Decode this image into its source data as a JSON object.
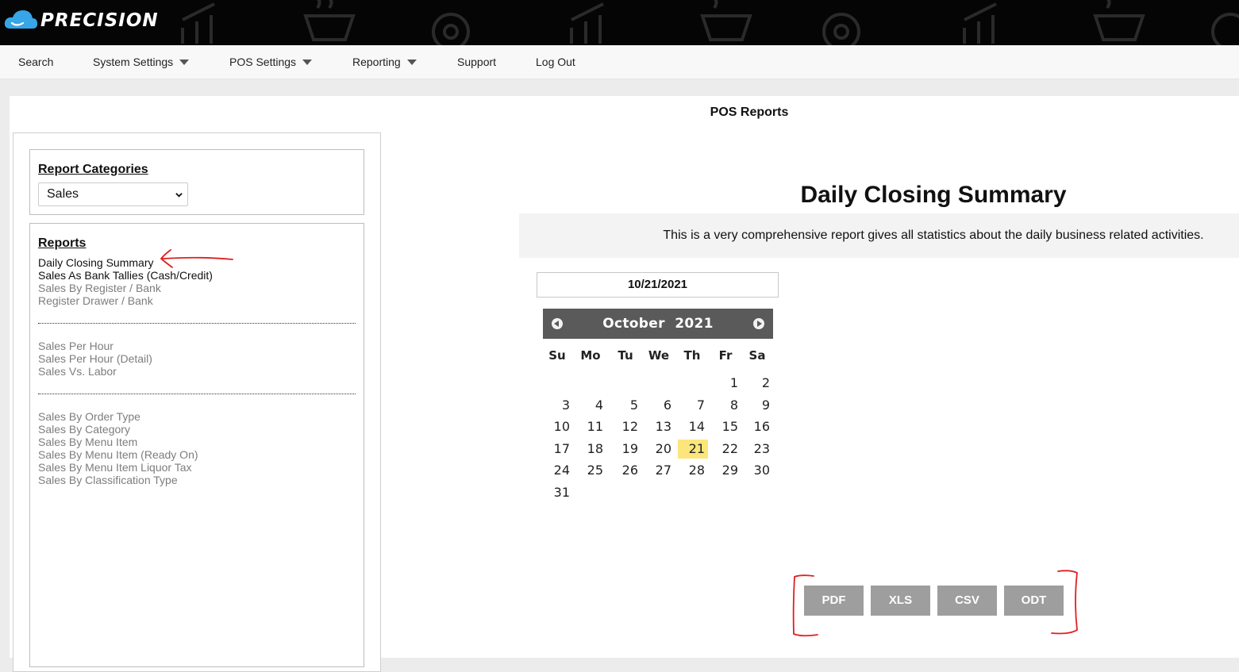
{
  "app": {
    "brand_name": "PRECISION"
  },
  "nav": {
    "items": [
      {
        "label": "Search"
      },
      {
        "label": "System Settings"
      },
      {
        "label": "POS Settings"
      },
      {
        "label": "Reporting"
      },
      {
        "label": "Support"
      },
      {
        "label": "Log Out"
      }
    ]
  },
  "page": {
    "title": "POS Reports"
  },
  "categories": {
    "heading": "Report Categories",
    "selected": "Sales"
  },
  "reports": {
    "heading": "Reports",
    "group1": [
      {
        "label": "Daily Closing Summary",
        "state": "active"
      },
      {
        "label": "Sales As Bank Tallies (Cash/Credit)",
        "state": "active"
      },
      {
        "label": "Sales By Register / Bank",
        "state": "muted"
      },
      {
        "label": "Register Drawer / Bank",
        "state": "muted"
      }
    ],
    "group2": [
      {
        "label": "Sales Per Hour",
        "state": "muted"
      },
      {
        "label": "Sales Per Hour (Detail)",
        "state": "muted"
      },
      {
        "label": "Sales Vs. Labor",
        "state": "muted"
      }
    ],
    "group3": [
      {
        "label": "Sales By Order Type",
        "state": "muted"
      },
      {
        "label": "Sales By Category",
        "state": "muted"
      },
      {
        "label": "Sales By Menu Item",
        "state": "muted"
      },
      {
        "label": "Sales By Menu Item (Ready On)",
        "state": "muted"
      },
      {
        "label": "Sales By Menu Item Liquor Tax",
        "state": "muted"
      },
      {
        "label": "Sales By Classification Type",
        "state": "muted"
      }
    ]
  },
  "report": {
    "title": "Daily Closing Summary",
    "description": "This is a very comprehensive report gives all statistics about the daily business related activities."
  },
  "date_input": {
    "value": "10/21/2021"
  },
  "calendar": {
    "month": "October",
    "year": "2021",
    "weekdays": [
      "Su",
      "Mo",
      "Tu",
      "We",
      "Th",
      "Fr",
      "Sa"
    ],
    "first_weekday_index": 5,
    "days_in_month": 31,
    "selected_day": 21
  },
  "export": {
    "buttons": [
      {
        "label": "PDF"
      },
      {
        "label": "XLS"
      },
      {
        "label": "CSV"
      },
      {
        "label": "ODT"
      }
    ]
  },
  "colors": {
    "banner": "#050505",
    "navbar": "#f8f8f8",
    "calendar_header": "#5a5a5a",
    "today_highlight": "#fce57a",
    "export_button": "#9e9e9e",
    "annotation": "#e02020"
  }
}
